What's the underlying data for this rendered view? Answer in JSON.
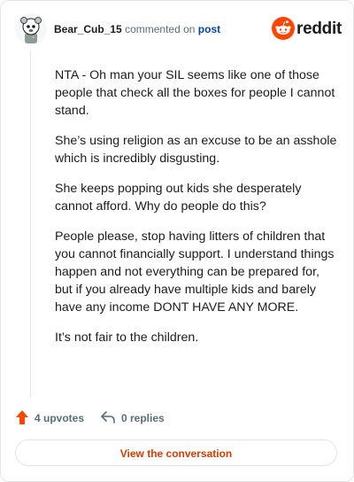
{
  "header": {
    "username": "Bear_Cub_15",
    "action_text": "commented on",
    "post_link": "post",
    "logo_wordmark": "reddit",
    "avatar_icon": "snoo-avatar-icon",
    "logo_icon": "reddit-snoo-icon"
  },
  "comment": {
    "paragraphs": [
      "NTA - Oh man your SIL seems like one of those people that check all the boxes for people I cannot stand.",
      "She’s using religion as an excuse to be an asshole which is incredibly disgusting.",
      "She keeps popping out kids she desperately cannot afford. Why do people do this?",
      "People please, stop having litters of children that you cannot financially support. I understand things happen and not everything can be prepared for, but if you already have multiple kids and barely have any income DONT HAVE ANY MORE.",
      "It’s not fair to the children."
    ]
  },
  "footer": {
    "upvotes_label": "4 upvotes",
    "replies_label": "0 replies",
    "upvote_icon": "upvote-arrow-icon",
    "reply_icon": "reply-arrow-icon"
  },
  "cta": {
    "label": "View the conversation"
  },
  "colors": {
    "brand_orange": "#ff4500",
    "cta_text": "#d93a00",
    "link_blue": "#0045ac",
    "meta_gray": "#576f76",
    "text": "#1c1c1c",
    "border": "#e3e5e8"
  }
}
